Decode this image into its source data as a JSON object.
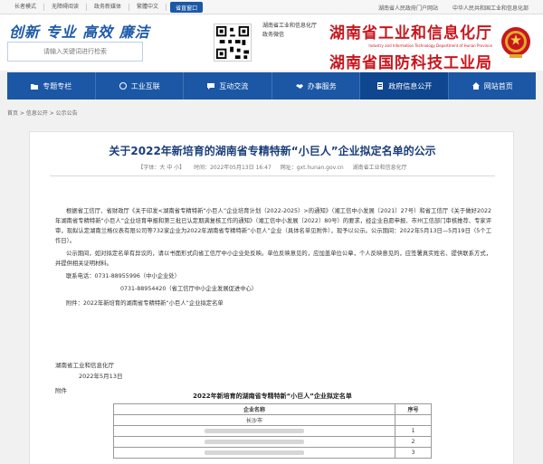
{
  "topbar": {
    "links_left": [
      "中华人民共和国工业和信息化部",
      "湖南省人民政府门户网站"
    ],
    "links_right": [
      "繁體中文",
      "政务新媒体",
      "无障碍阅读",
      "长者模式"
    ],
    "pill": "省直窗口"
  },
  "header": {
    "slogan": "创新 专业 高效 廉洁",
    "search_placeholder": "请输入关键词进行检索",
    "qr_label": "湖南省工业和信息化厅\n政务微信",
    "org_name_1": "湖南省工业和信息化厅",
    "org_name_1_en": "Industry and Information Technology Department of Hunan Province",
    "org_name_2": "湖南省国防科技工业局"
  },
  "nav": {
    "items": [
      {
        "label": "网站首页",
        "icon": "home-icon"
      },
      {
        "label": "政府信息公开",
        "icon": "document-icon"
      },
      {
        "label": "办事服务",
        "icon": "handshake-icon"
      },
      {
        "label": "互动交流",
        "icon": "chat-icon"
      },
      {
        "label": "工业互联",
        "icon": "network-icon"
      },
      {
        "label": "专题专栏",
        "icon": "folder-icon"
      }
    ]
  },
  "breadcrumb": "首页 > 信息公开 > 公示公告",
  "article": {
    "title": "关于2022年新培育的湖南省专精特新“小巨人”企业拟定名单的公示",
    "source": "湖南省工业和信息化厅",
    "site": "网址：gxt.hunan.gov.cn",
    "time": "时间：2022年05月13日 16:47",
    "font_size": "【字体：大 中 小】",
    "paragraphs": [
      "根据省工信厅、省财政厅《关于印发<湖南省专精特新“小巨人”企业培育计划（2022-2025）>的通知》（湘工信中小发展〔2021〕27号）和省工信厅《关于做好2022年湖南省专精特新“小巨人”企业培育申报和第三批已认定期满复核工作的通知》（湘工信中小发展〔2022〕80号）的要求，经企业自愿申报、市州工信部门审核推荐、专家评审，现拟认定湖南兰格仪表有限公司等732家企业为2022年湖南省专精特新“小巨人”企业（具体名单见附件），现予以公示。公示期间：2022年5月13日—5月19日（5个工作日）。",
      "公示期间，如对拟定名单有异议的，请以书面形式向省工信厅中小企业处反映。单位反映意见的，应加盖单位公章，个人反映意见的，应签署真实姓名、提供联系方式，并提供相关证明材料。",
      "联系电话：0731-88955996（中小企业处）",
      "0731-88954420（省工信厅中小企业发展促进中心）"
    ],
    "attachment_line": "附件：2022年新培育的湖南省专精特新“小巨人”企业拟定名单",
    "signature": "湖南省工业和信息化厅",
    "date": "2022年5月13日",
    "attach_label": "附件",
    "list_title": "2022年新培育的湖南省专精特新“小巨人”企业拟定名单",
    "table": {
      "headers": [
        "序号",
        "企业名称"
      ],
      "group": "长沙市",
      "rows": [
        "1",
        "2",
        "3"
      ]
    }
  }
}
